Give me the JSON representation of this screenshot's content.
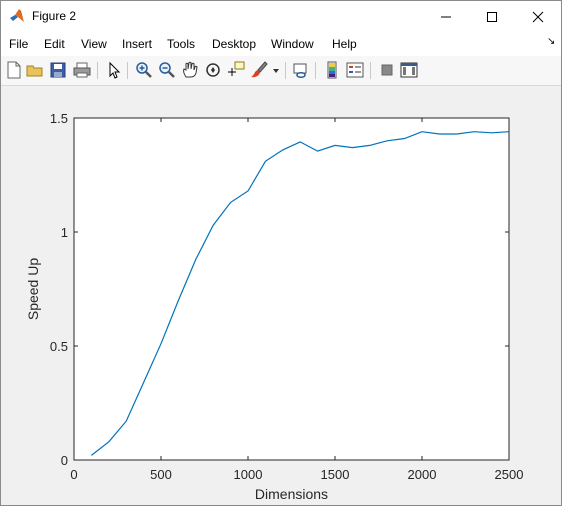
{
  "window": {
    "title": "Figure 2",
    "controls": [
      "minimize-icon",
      "maximize-icon",
      "close-icon"
    ]
  },
  "menubar": {
    "items": [
      {
        "label": "File"
      },
      {
        "label": "Edit"
      },
      {
        "label": "View"
      },
      {
        "label": "Insert"
      },
      {
        "label": "Tools"
      },
      {
        "label": "Desktop"
      },
      {
        "label": "Window"
      },
      {
        "label": "Help"
      }
    ]
  },
  "toolbar": {
    "icons": [
      "new-figure-icon",
      "open-file-icon",
      "save-icon",
      "print-icon",
      "pointer-icon",
      "zoom-in-icon",
      "zoom-out-icon",
      "pan-icon",
      "rotate-3d-icon",
      "data-cursor-icon",
      "brush-icon",
      "brush-dropdown-icon",
      "link-plot-icon",
      "colorbar-icon",
      "legend-icon",
      "hide-plot-tools-icon",
      "show-plot-tools-icon"
    ]
  },
  "chart_data": {
    "type": "line",
    "title": "",
    "xlabel": "Dimensions",
    "ylabel": "Speed Up",
    "xlim": [
      0,
      2500
    ],
    "ylim": [
      0,
      1.5
    ],
    "xticks": [
      0,
      500,
      1000,
      1500,
      2000,
      2500
    ],
    "yticks": [
      0,
      0.5,
      1,
      1.5
    ],
    "xtick_labels": [
      "0",
      "500",
      "1000",
      "1500",
      "2000",
      "2500"
    ],
    "ytick_labels": [
      "0",
      "0.5",
      "1",
      "1.5"
    ],
    "grid": false,
    "series": [
      {
        "color": "#0072bd",
        "x": [
          100,
          200,
          300,
          400,
          500,
          600,
          700,
          800,
          900,
          1000,
          1100,
          1200,
          1300,
          1400,
          1500,
          1600,
          1700,
          1800,
          1900,
          2000,
          2100,
          2200,
          2300,
          2400,
          2500
        ],
        "y": [
          0.02,
          0.08,
          0.17,
          0.34,
          0.51,
          0.7,
          0.88,
          1.03,
          1.13,
          1.18,
          1.31,
          1.36,
          1.395,
          1.355,
          1.38,
          1.37,
          1.38,
          1.4,
          1.41,
          1.44,
          1.43,
          1.43,
          1.44,
          1.435,
          1.44
        ]
      }
    ]
  }
}
